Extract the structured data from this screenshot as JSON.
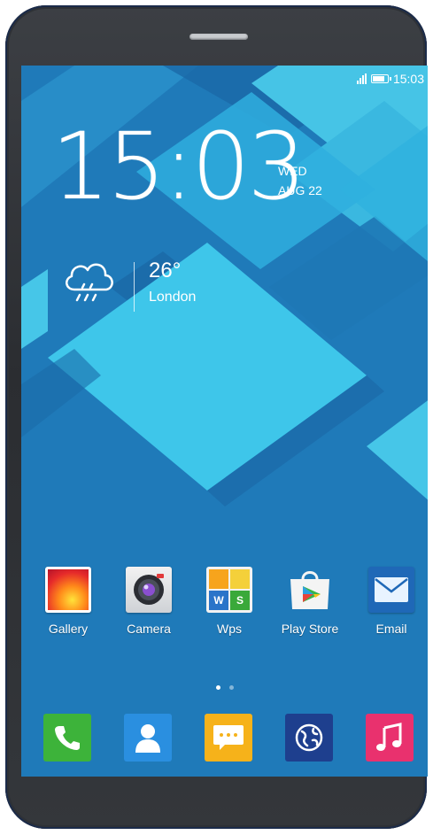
{
  "status_bar": {
    "time": "15:03",
    "signal_icon": "signal-bars-icon",
    "battery_icon": "battery-icon",
    "battery_level": 0.85
  },
  "clock_widget": {
    "time": "15:03",
    "day": "WED",
    "date": "AUG 22"
  },
  "weather_widget": {
    "icon": "cloud-rain-icon",
    "temperature": "26°",
    "city": "London"
  },
  "apps": [
    {
      "label": "Gallery",
      "icon": "gallery-icon"
    },
    {
      "label": "Camera",
      "icon": "camera-icon"
    },
    {
      "label": "Wps",
      "icon": "wps-office-icon"
    },
    {
      "label": "Play Store",
      "icon": "play-store-icon"
    },
    {
      "label": "Email",
      "icon": "envelope-icon"
    }
  ],
  "pager": {
    "pages": 2,
    "active": 0
  },
  "dock": [
    {
      "icon": "phone-icon",
      "color": "#3db33a"
    },
    {
      "icon": "contacts-icon",
      "color": "#2a8fe0"
    },
    {
      "icon": "messaging-icon",
      "color": "#f6b21a"
    },
    {
      "icon": "browser-globe-icon",
      "color": "#1e3f8e"
    },
    {
      "icon": "music-icon",
      "color": "#e9316e"
    }
  ],
  "colors": {
    "bezel": "#2f3236",
    "wallpaper_base": "#1f7ab9",
    "wallpaper_light": "#3fc8ea",
    "wallpaper_dark": "#175f99"
  }
}
